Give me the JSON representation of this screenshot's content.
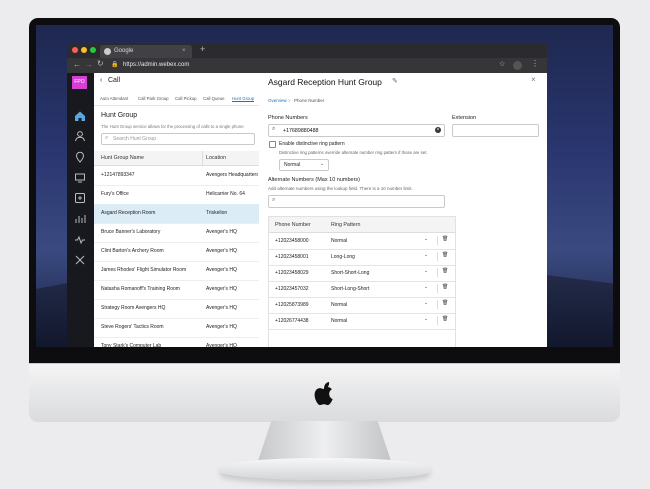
{
  "browser": {
    "tab_title": "Google",
    "url": "https://admin.webex.com",
    "new_tab": "+"
  },
  "nav": {
    "avatar_initials": "FPO"
  },
  "left": {
    "back_label": "Call",
    "tabs": [
      "Auto Attendant",
      "Call Park Group",
      "Call Pickup",
      "Call Queue",
      "Hunt Group"
    ],
    "section_title": "Hunt Group",
    "description": "The Hunt Group service allows for the processing of calls to a single phone",
    "search_placeholder": "Search Hunt Group",
    "col_name": "Hunt Group Name",
    "col_location": "Location",
    "rows": [
      {
        "name": "+12147893347",
        "location": "Avengers Headquarters"
      },
      {
        "name": "Fury's Office",
        "location": "Helicarrier No. 64"
      },
      {
        "name": "Asgard Reception Room",
        "location": "Triskelion"
      },
      {
        "name": "Bruce Banner's Laboratory",
        "location": "Avenger's HQ"
      },
      {
        "name": "Clint Barton's Archery Room",
        "location": "Avenger's HQ"
      },
      {
        "name": "James Rhodes' Flight Simulator Room",
        "location": "Avenger's HQ"
      },
      {
        "name": "Natasha Romanoff's Training Room",
        "location": "Avenger's HQ"
      },
      {
        "name": "Strategy Room Avengers HQ",
        "location": "Avenger's HQ"
      },
      {
        "name": "Steve Rogers' Tactics Room",
        "location": "Avenger's HQ"
      },
      {
        "name": "Tony Stark's Computer Lab",
        "location": "Avenger's HQ"
      }
    ]
  },
  "right": {
    "title": "Asgard Reception Hunt Group",
    "crumb_overview": "Overview",
    "crumb_sep": ">",
    "crumb_current": "Phone Number",
    "phone_numbers_label": "Phone Numbers",
    "extension_label": "Extension",
    "phone_value": "+17689880488",
    "distinctive_label": "Enable distinctive ring pattern",
    "distinctive_help": "Distinctive ring patterns override alternate number ring pattern if those are set.",
    "ring_select": "Normal",
    "alt_title": "Alternate Numbers (Max 10 numbers)",
    "alt_help": "Add alternate numbers using the lookup field. There is a 10 number limit.",
    "col_phone": "Phone Number",
    "col_ring": "Ring Pattern",
    "alt_rows": [
      {
        "phone": "+12023458000",
        "ring": "Normal"
      },
      {
        "phone": "+12023458001",
        "ring": "Long-Long"
      },
      {
        "phone": "+12023458029",
        "ring": "Short-Short-Long"
      },
      {
        "phone": "+12023457032",
        "ring": "Short-Long-Short"
      },
      {
        "phone": "+12025873989",
        "ring": "Normal"
      },
      {
        "phone": "+12026774438",
        "ring": "Normal"
      }
    ]
  }
}
